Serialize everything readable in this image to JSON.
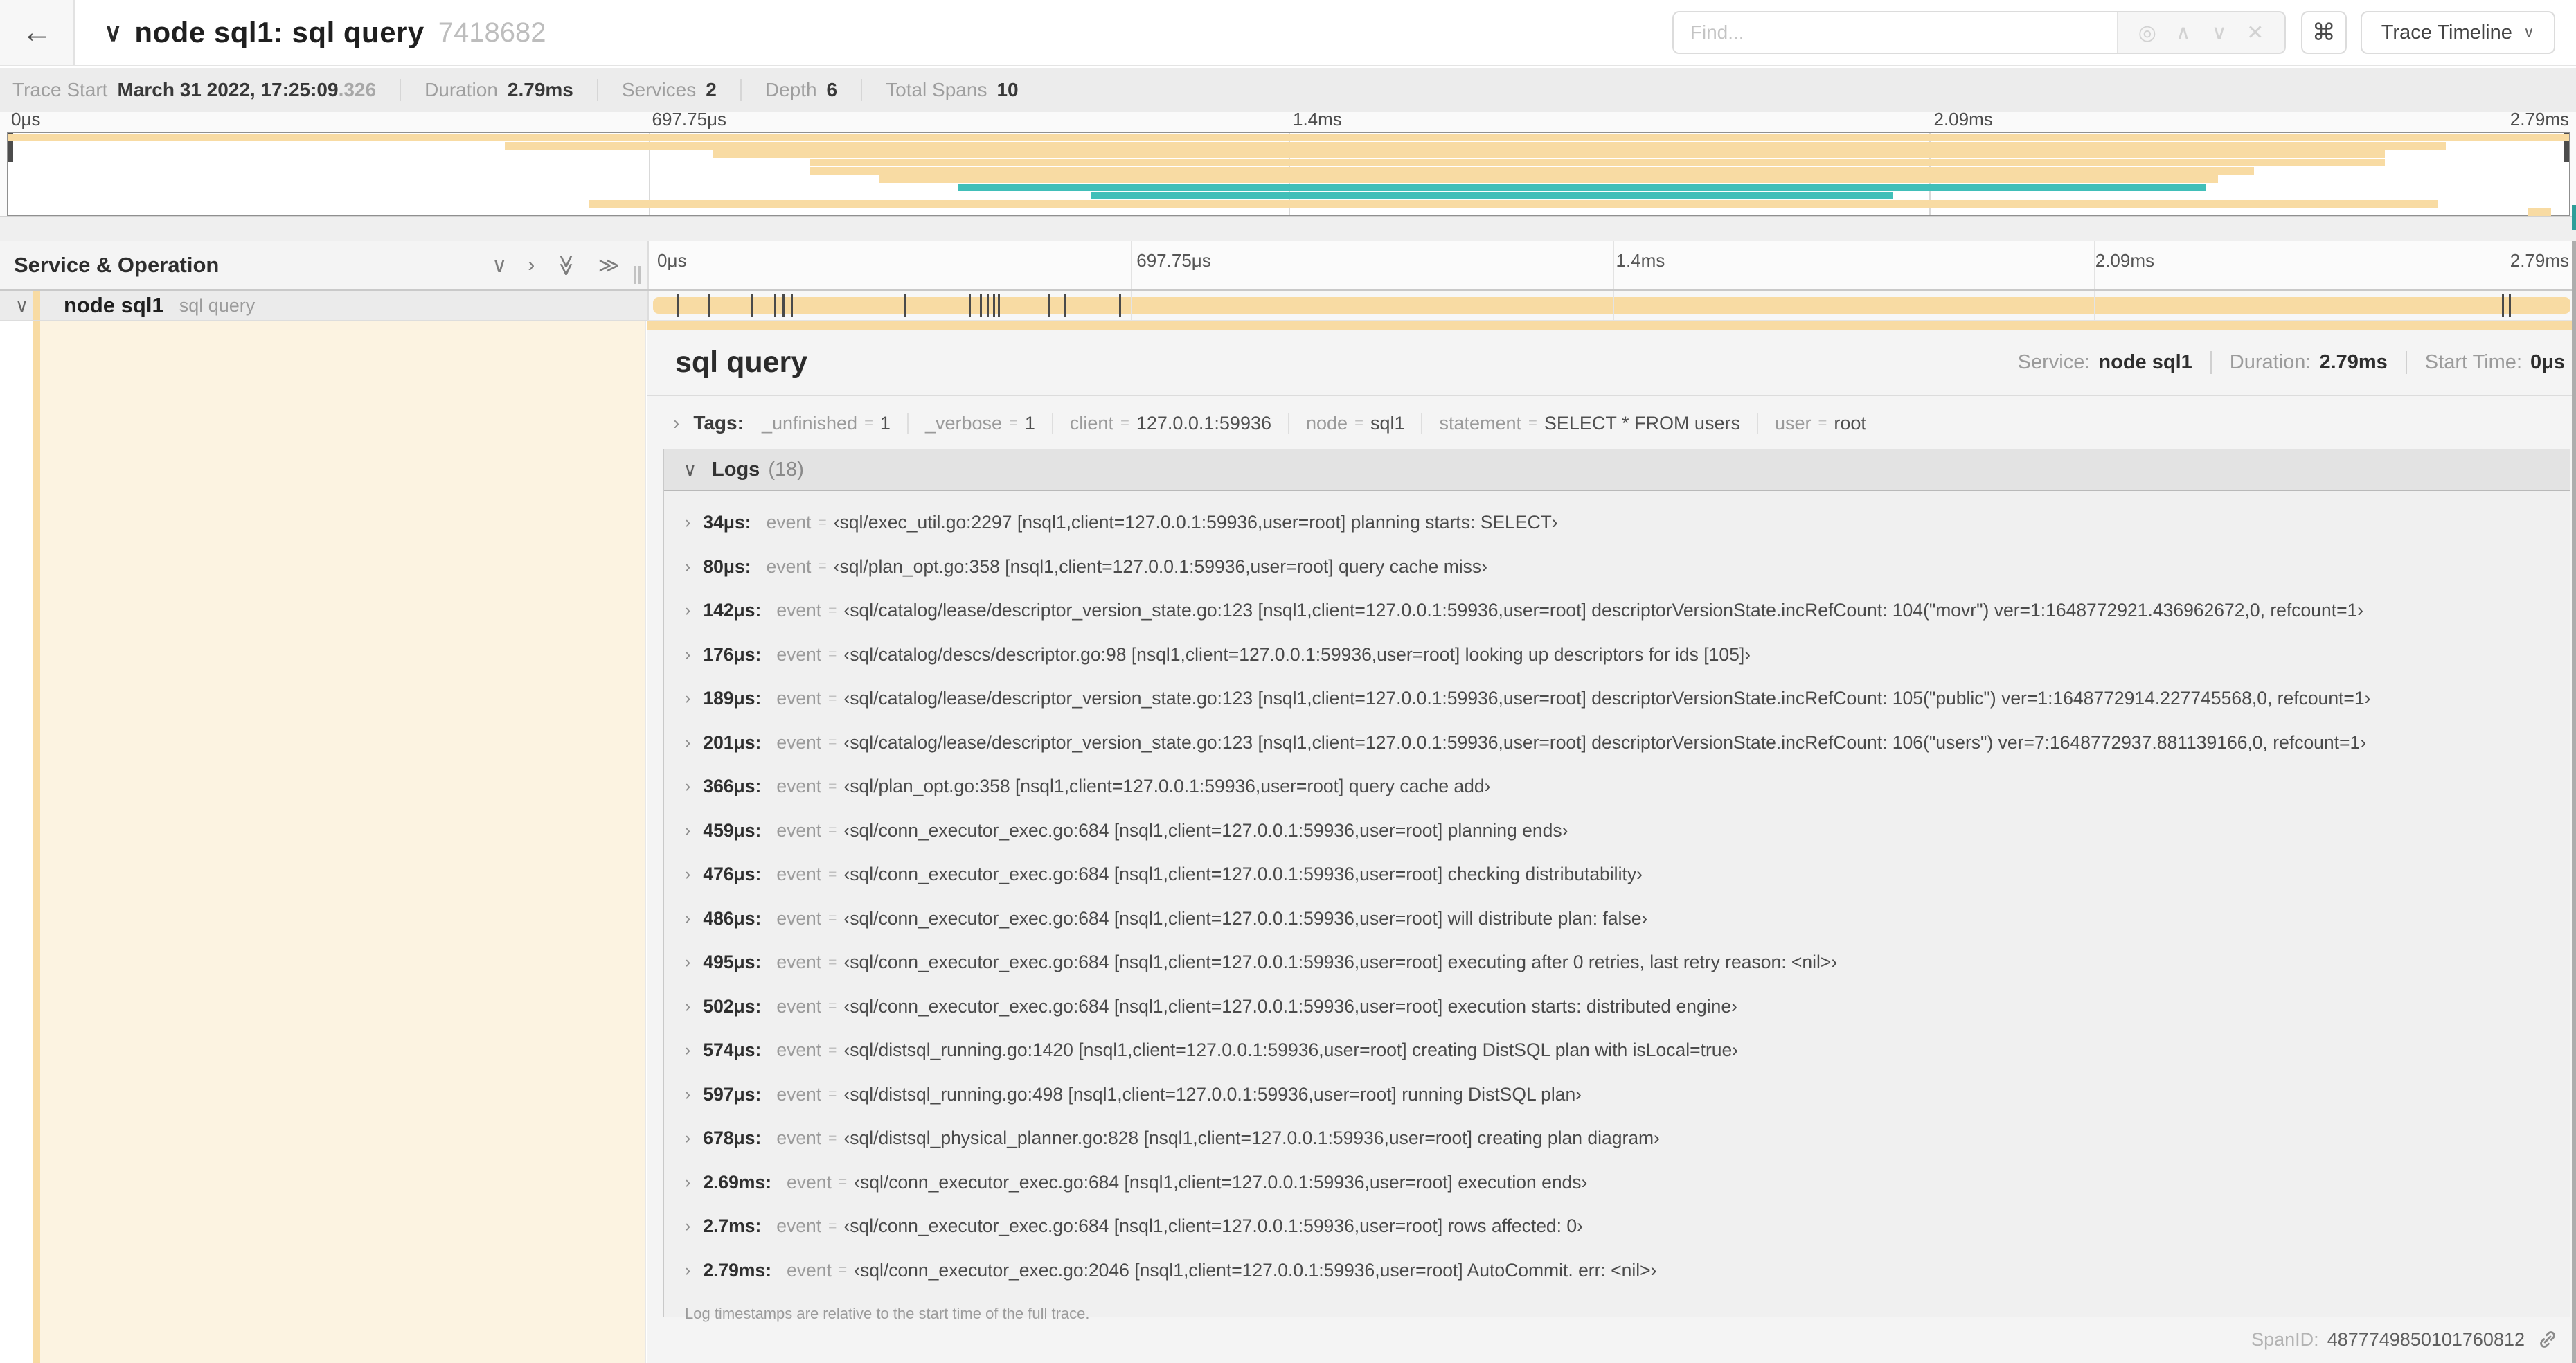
{
  "header": {
    "title": "node sql1: sql query",
    "trace_id": "7418682",
    "find_placeholder": "Find...",
    "view_selector": "Trace Timeline"
  },
  "icons": {
    "back": "←",
    "title_chevron": "∨",
    "crosshair": "◎",
    "prev_match": "∧",
    "next_match": "∨",
    "clear": "✕",
    "command": "⌘",
    "dropdown_chevron": "∨",
    "collapse_one": "∨",
    "expand_one": "›",
    "collapse_all": "≫",
    "expand_all": "≫",
    "row_chevron": "∨",
    "tags_chevron": "›",
    "logs_chevron": "∨",
    "log_row_chevron": "›",
    "eq": "="
  },
  "trace_info": {
    "items": [
      {
        "label": "Trace Start",
        "value": "March 31 2022, 17:25:09",
        "suffix": ".326"
      },
      {
        "label": "Duration",
        "value": "2.79ms"
      },
      {
        "label": "Services",
        "value": "2"
      },
      {
        "label": "Depth",
        "value": "6"
      },
      {
        "label": "Total Spans",
        "value": "10"
      }
    ]
  },
  "timeline": {
    "ticks": [
      {
        "label": "0μs",
        "pct": 0
      },
      {
        "label": "697.75μs",
        "pct": 25
      },
      {
        "label": "1.4ms",
        "pct": 50
      },
      {
        "label": "2.09ms",
        "pct": 75
      },
      {
        "label": "2.79ms",
        "pct": 100
      }
    ],
    "colors": {
      "tan": "#f8dba3",
      "teal": "#41bfb9"
    },
    "minimap_spans": [
      {
        "row": 0,
        "start": 0,
        "end": 100,
        "color": "tan"
      },
      {
        "row": 1,
        "start": 19.4,
        "end": 95.2,
        "color": "tan"
      },
      {
        "row": 2,
        "start": 27.5,
        "end": 92.8,
        "color": "tan"
      },
      {
        "row": 3,
        "start": 31.3,
        "end": 92.8,
        "color": "tan"
      },
      {
        "row": 4,
        "start": 31.3,
        "end": 87.7,
        "color": "tan"
      },
      {
        "row": 5,
        "start": 34.0,
        "end": 86.3,
        "color": "tan"
      },
      {
        "row": 6,
        "start": 37.1,
        "end": 85.8,
        "color": "teal"
      },
      {
        "row": 7,
        "start": 42.3,
        "end": 73.6,
        "color": "teal"
      },
      {
        "row": 8,
        "start": 22.7,
        "end": 94.9,
        "color": "tan"
      },
      {
        "row": 9,
        "start": 98.4,
        "end": 99.3,
        "color": "tan"
      }
    ],
    "log_marker_pcts": [
      1.22,
      2.87,
      5.09,
      6.31,
      6.77,
      7.2,
      13.12,
      16.45,
      17.06,
      17.42,
      17.74,
      17.99,
      20.57,
      21.4,
      24.3,
      96.42,
      96.77
    ]
  },
  "span_list": {
    "header": "Service & Operation",
    "row": {
      "service": "node sql1",
      "operation": "sql query"
    }
  },
  "detail": {
    "title": "sql query",
    "meta": [
      {
        "label": "Service:",
        "value": "node sql1"
      },
      {
        "label": "Duration:",
        "value": "2.79ms"
      },
      {
        "label": "Start Time:",
        "value": "0μs"
      }
    ],
    "tags_label": "Tags:",
    "tags": [
      {
        "key": "_unfinished",
        "value": "1"
      },
      {
        "key": "_verbose",
        "value": "1"
      },
      {
        "key": "client",
        "value": "127.0.0.1:59936"
      },
      {
        "key": "node",
        "value": "sql1"
      },
      {
        "key": "statement",
        "value": "SELECT * FROM users"
      },
      {
        "key": "user",
        "value": "root"
      }
    ],
    "logs_label": "Logs",
    "logs_count": "(18)",
    "log_field_key": "event",
    "logs": [
      {
        "time": "34μs:",
        "value": "‹sql/exec_util.go:2297 [nsql1,client=127.0.0.1:59936,user=root] planning starts: SELECT›"
      },
      {
        "time": "80μs:",
        "value": "‹sql/plan_opt.go:358 [nsql1,client=127.0.0.1:59936,user=root] query cache miss›"
      },
      {
        "time": "142μs:",
        "value": "‹sql/catalog/lease/descriptor_version_state.go:123 [nsql1,client=127.0.0.1:59936,user=root] descriptorVersionState.incRefCount: 104(\"movr\") ver=1:1648772921.436962672,0, refcount=1›"
      },
      {
        "time": "176μs:",
        "value": "‹sql/catalog/descs/descriptor.go:98 [nsql1,client=127.0.0.1:59936,user=root] looking up descriptors for ids [105]›"
      },
      {
        "time": "189μs:",
        "value": "‹sql/catalog/lease/descriptor_version_state.go:123 [nsql1,client=127.0.0.1:59936,user=root] descriptorVersionState.incRefCount: 105(\"public\") ver=1:1648772914.227745568,0, refcount=1›"
      },
      {
        "time": "201μs:",
        "value": "‹sql/catalog/lease/descriptor_version_state.go:123 [nsql1,client=127.0.0.1:59936,user=root] descriptorVersionState.incRefCount: 106(\"users\") ver=7:1648772937.881139166,0, refcount=1›"
      },
      {
        "time": "366μs:",
        "value": "‹sql/plan_opt.go:358 [nsql1,client=127.0.0.1:59936,user=root] query cache add›"
      },
      {
        "time": "459μs:",
        "value": "‹sql/conn_executor_exec.go:684 [nsql1,client=127.0.0.1:59936,user=root] planning ends›"
      },
      {
        "time": "476μs:",
        "value": "‹sql/conn_executor_exec.go:684 [nsql1,client=127.0.0.1:59936,user=root] checking distributability›"
      },
      {
        "time": "486μs:",
        "value": "‹sql/conn_executor_exec.go:684 [nsql1,client=127.0.0.1:59936,user=root] will distribute plan: false›"
      },
      {
        "time": "495μs:",
        "value": "‹sql/conn_executor_exec.go:684 [nsql1,client=127.0.0.1:59936,user=root] executing after 0 retries, last retry reason: <nil>›"
      },
      {
        "time": "502μs:",
        "value": "‹sql/conn_executor_exec.go:684 [nsql1,client=127.0.0.1:59936,user=root] execution starts: distributed engine›"
      },
      {
        "time": "574μs:",
        "value": "‹sql/distsql_running.go:1420 [nsql1,client=127.0.0.1:59936,user=root] creating DistSQL plan with isLocal=true›"
      },
      {
        "time": "597μs:",
        "value": "‹sql/distsql_running.go:498 [nsql1,client=127.0.0.1:59936,user=root] running DistSQL plan›"
      },
      {
        "time": "678μs:",
        "value": "‹sql/distsql_physical_planner.go:828 [nsql1,client=127.0.0.1:59936,user=root] creating plan diagram›"
      },
      {
        "time": "2.69ms:",
        "value": "‹sql/conn_executor_exec.go:684 [nsql1,client=127.0.0.1:59936,user=root] execution ends›"
      },
      {
        "time": "2.7ms:",
        "value": "‹sql/conn_executor_exec.go:684 [nsql1,client=127.0.0.1:59936,user=root] rows affected: 0›"
      },
      {
        "time": "2.79ms:",
        "value": "‹sql/conn_executor_exec.go:2046 [nsql1,client=127.0.0.1:59936,user=root] AutoCommit. err: <nil>›"
      }
    ],
    "footer_note": "Log timestamps are relative to the start time of the full trace.",
    "span_id_label": "SpanID:",
    "span_id": "4877749850101760812"
  }
}
